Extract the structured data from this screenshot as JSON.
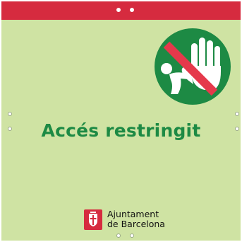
{
  "sign": {
    "title": "Accés restringit",
    "organization_line1": "Ajuntament",
    "organization_line2": "de Barcelona"
  },
  "icons": {
    "prohibition_badge": "no-entry-hand-stop-icon",
    "logo_mark": "barcelona-coat-of-arms-icon"
  },
  "colors": {
    "background": "#cfe3a3",
    "top_bar": "#d62b3f",
    "accent_green": "#1d8a44",
    "prohibition_red": "#e5394b",
    "white": "#ffffff"
  }
}
